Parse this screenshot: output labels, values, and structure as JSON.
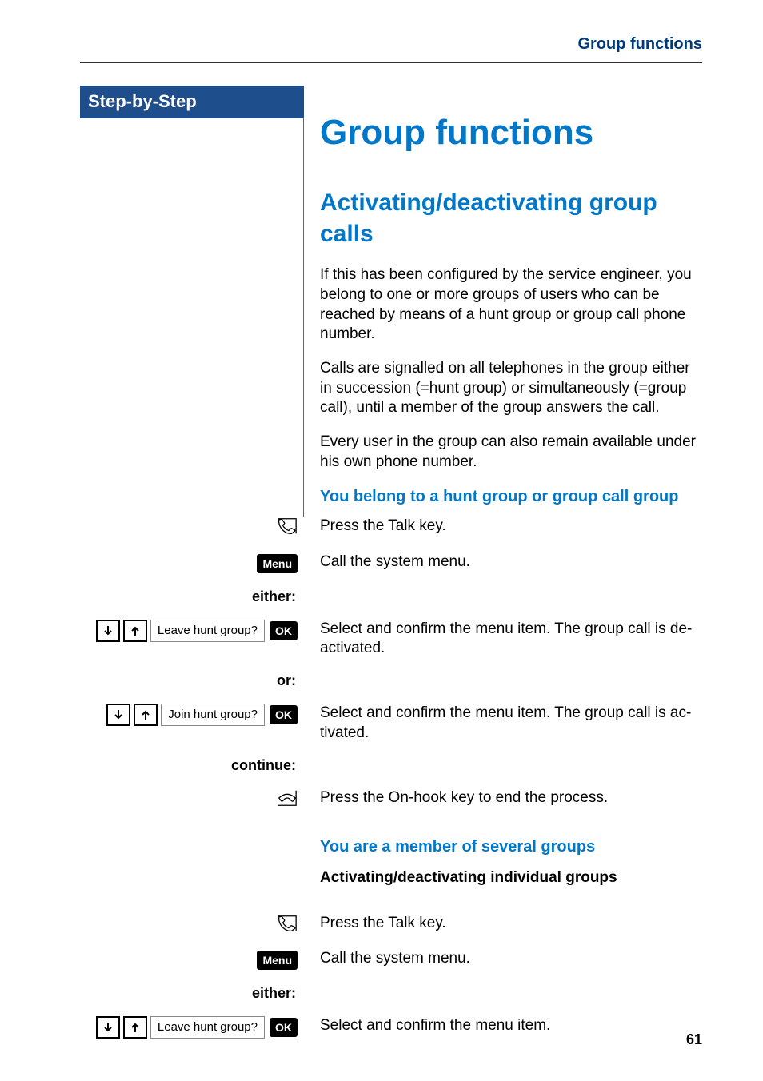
{
  "running_head": "Group functions",
  "sidebar_title": "Step-by-Step",
  "chapter_title": "Group functions",
  "section_title": "Activating/deactivating group calls",
  "para1": "If this has been configured by the service engineer, you belong to one or more groups of users who can be reached by means of a hunt group or group call phone number.",
  "para2": "Calls are signalled on all telephones in the group either in succession (=hunt group) or simultaneously (=group call), until a member of the group answers the call.",
  "para3": "Every user in the group can also remain available under his own phone number.",
  "sub1": "You belong to a hunt group or group call group",
  "sub2": "You are a member of several groups",
  "subsub1": "Activating/deactivating individual groups",
  "labels": {
    "menu": "Menu",
    "ok": "OK",
    "either": "either:",
    "or": "or:",
    "continue": "continue:"
  },
  "display": {
    "leave": "Leave hunt group?",
    "join": "Join hunt group?"
  },
  "steps": {
    "talk": "Press the Talk key.",
    "call_menu": "Call the system menu.",
    "leave_confirm": "Select and confirm the menu item. The group call is de-activated.",
    "join_confirm": "Select and confirm the menu item. The group call is ac-tivated.",
    "onhook": "Press the On-hook key to end the process.",
    "select_confirm": "Select and confirm the menu item."
  },
  "page_number": "61"
}
